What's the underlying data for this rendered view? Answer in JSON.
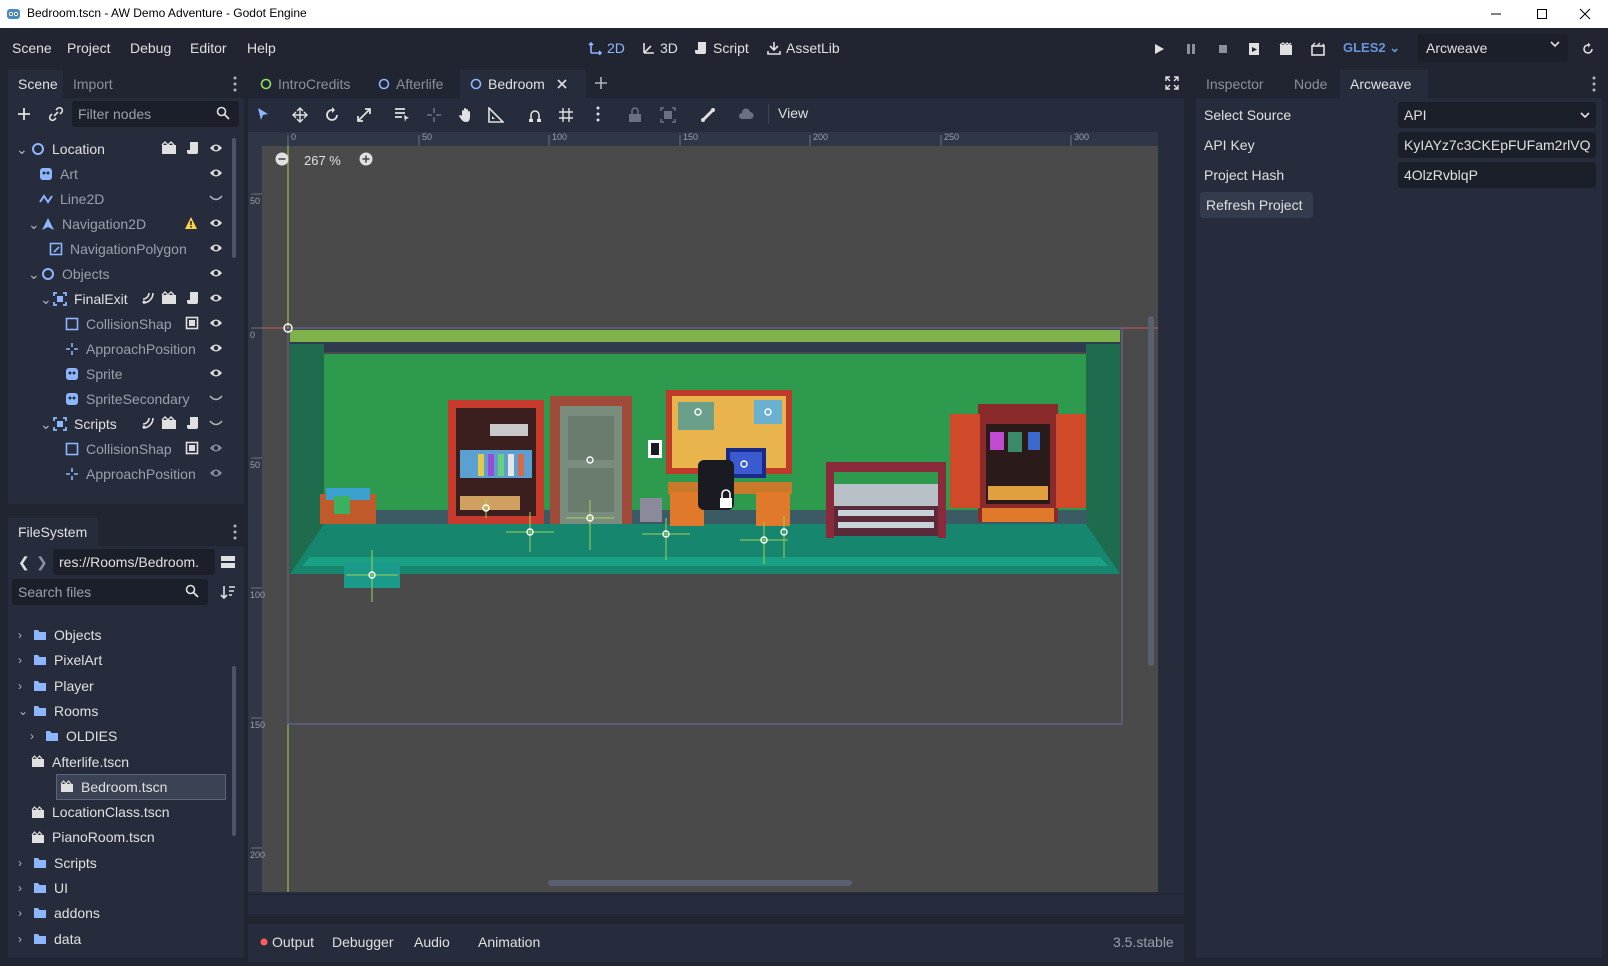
{
  "window": {
    "title": "Bedroom.tscn - AW Demo Adventure - Godot Engine"
  },
  "menu": [
    "Scene",
    "Project",
    "Debug",
    "Editor",
    "Help"
  ],
  "workspaces": {
    "w2d": "2D",
    "w3d": "3D",
    "script": "Script",
    "assetlib": "AssetLib"
  },
  "renderer": "GLES2",
  "plugin_select": "Arcweave",
  "scene_dock": {
    "tabs": [
      "Scene",
      "Import"
    ],
    "filter_placeholder": "Filter nodes",
    "nodes": [
      {
        "label": "Location",
        "icon": "node2d-icon"
      },
      {
        "label": "Art",
        "icon": "sprite-icon"
      },
      {
        "label": "Line2D",
        "icon": "line2d-icon"
      },
      {
        "label": "Navigation2D",
        "icon": "navigation2d-icon"
      },
      {
        "label": "NavigationPolygon",
        "icon": "navpoly-icon"
      },
      {
        "label": "Objects",
        "icon": "node2d-icon"
      },
      {
        "label": "FinalExit",
        "icon": "area2d-icon"
      },
      {
        "label": "CollisionShap",
        "icon": "collision-icon"
      },
      {
        "label": "ApproachPosition",
        "icon": "position2d-icon"
      },
      {
        "label": "Sprite",
        "icon": "sprite-icon"
      },
      {
        "label": "SpriteSecondary",
        "icon": "sprite-icon"
      },
      {
        "label": "Scripts",
        "icon": "area2d-icon"
      },
      {
        "label": "CollisionShap",
        "icon": "collision-icon"
      },
      {
        "label": "ApproachPosition",
        "icon": "position2d-icon"
      }
    ]
  },
  "filesystem": {
    "tab": "FileSystem",
    "path": "res://Rooms/Bedroom.",
    "search_placeholder": "Search files",
    "items": [
      {
        "label": "Objects",
        "type": "folder"
      },
      {
        "label": "PixelArt",
        "type": "folder"
      },
      {
        "label": "Player",
        "type": "folder"
      },
      {
        "label": "Rooms",
        "type": "folder"
      },
      {
        "label": "OLDIES",
        "type": "folder"
      },
      {
        "label": "Afterlife.tscn",
        "type": "scene"
      },
      {
        "label": "Bedroom.tscn",
        "type": "scene"
      },
      {
        "label": "LocationClass.tscn",
        "type": "scene"
      },
      {
        "label": "PianoRoom.tscn",
        "type": "scene"
      },
      {
        "label": "Scripts",
        "type": "folder"
      },
      {
        "label": "UI",
        "type": "folder"
      },
      {
        "label": "addons",
        "type": "folder"
      },
      {
        "label": "data",
        "type": "folder"
      }
    ]
  },
  "scene_tabs": [
    "IntroCredits",
    "Afterlife",
    "Bedroom"
  ],
  "toolbar": {
    "view_label": "View"
  },
  "viewport": {
    "zoom": "267 %",
    "ruler_labels": [
      "0",
      "50",
      "100",
      "150",
      "200",
      "250",
      "300"
    ],
    "vruler_labels": [
      "50",
      "0",
      "50",
      "100",
      "150",
      "200"
    ]
  },
  "bottom_panel": {
    "tabs": [
      "Output",
      "Debugger",
      "Audio",
      "Animation"
    ],
    "version": "3.5.stable"
  },
  "inspector": {
    "tabs": [
      "Inspector",
      "Node",
      "Arcweave"
    ],
    "fields": [
      {
        "label": "Select Source",
        "value": "API"
      },
      {
        "label": "API Key",
        "value": "KyIAYz7c3CKEpFUFam2rlVQ"
      },
      {
        "label": "Project Hash",
        "value": "4OlzRvblqP"
      }
    ],
    "refresh_button": "Refresh Project"
  },
  "colors": {
    "accent": "#8eb6ff",
    "panel": "#262c3b",
    "background": "#202531",
    "viewport": "#4a4a4a",
    "warning": "#ffd24a",
    "error_dot": "#ff5d5d"
  }
}
